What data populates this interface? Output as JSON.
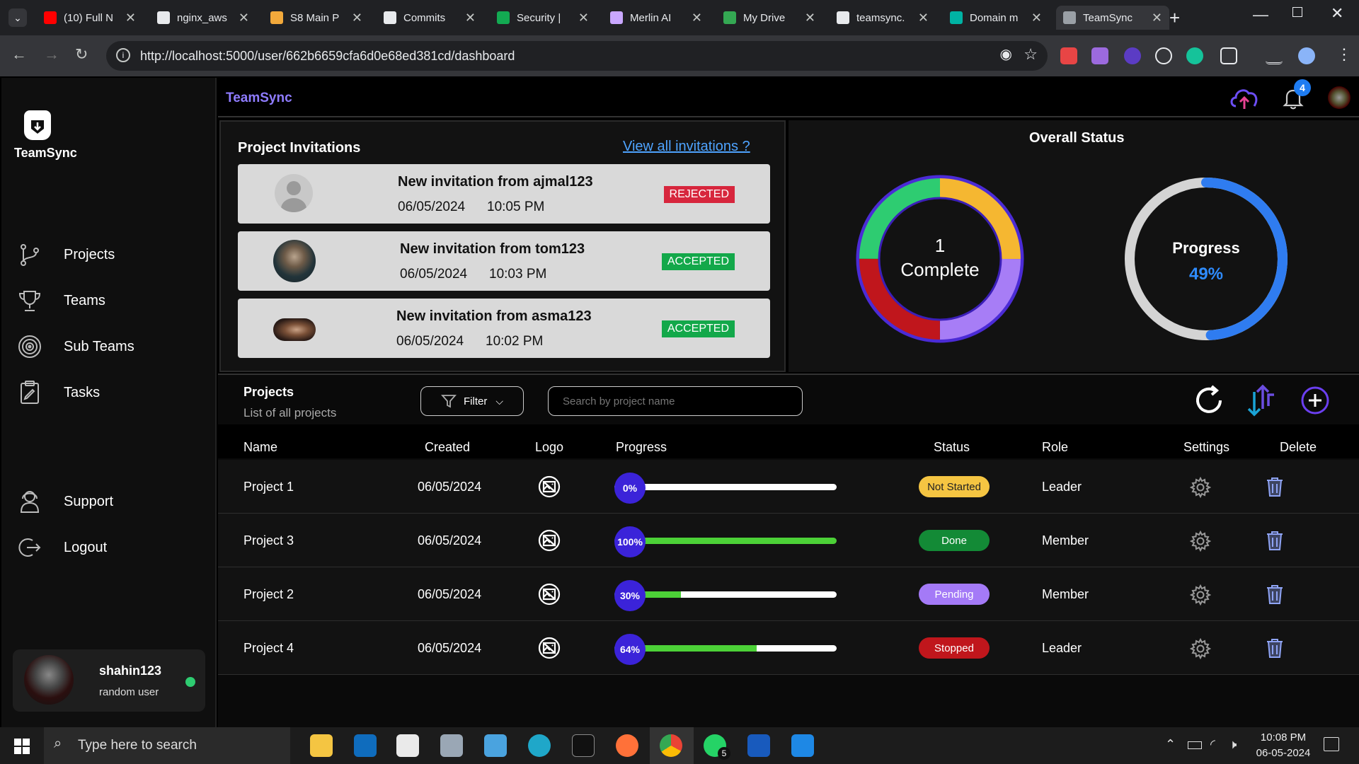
{
  "browser": {
    "tabs": [
      {
        "title": "(10) Full N",
        "color": "#ff0000"
      },
      {
        "title": "nginx_aws",
        "color": "#e8eaed"
      },
      {
        "title": "S8 Main P",
        "color": "#f2a93b"
      },
      {
        "title": "Commits",
        "color": "#e8eaed"
      },
      {
        "title": "Security |",
        "color": "#13aa52"
      },
      {
        "title": "Merlin AI",
        "color": "#c9a7ff"
      },
      {
        "title": "My Drive",
        "color": "#34a853"
      },
      {
        "title": "teamsync.",
        "color": "#e8eaed"
      },
      {
        "title": "Domain m",
        "color": "#00b3a4"
      },
      {
        "title": "TeamSync",
        "color": "#9aa0a6"
      }
    ],
    "url": "http://localhost:5000/user/662b6659cfa6d0e68ed381cd/dashboard"
  },
  "app": {
    "brand": "TeamSync",
    "sidebar": {
      "logo_label": "TeamSync",
      "items": [
        {
          "label": "Projects",
          "icon": "branch-icon"
        },
        {
          "label": "Teams",
          "icon": "trophy-icon"
        },
        {
          "label": "Sub Teams",
          "icon": "target-icon"
        },
        {
          "label": "Tasks",
          "icon": "clipboard-icon"
        },
        {
          "label": "Support",
          "icon": "support-icon"
        },
        {
          "label": "Logout",
          "icon": "logout-icon"
        }
      ],
      "user": {
        "name": "shahin123",
        "role": "random user",
        "online_color": "#2ecc71"
      }
    },
    "header": {
      "notification_count": "4"
    },
    "invitations": {
      "title": "Project Invitations",
      "view_all": "View all invitations ?",
      "items": [
        {
          "text": "New invitation from ajmal123",
          "date": "06/05/2024",
          "time": "10:05 PM",
          "status": "REJECTED",
          "color": "#d7263d"
        },
        {
          "text": "New invitation from tom123",
          "date": "06/05/2024",
          "time": "10:03 PM",
          "status": "ACCEPTED",
          "color": "#13a84a"
        },
        {
          "text": "New invitation from asma123",
          "date": "06/05/2024",
          "time": "10:02 PM",
          "status": "ACCEPTED",
          "color": "#13a84a"
        }
      ]
    },
    "overall": {
      "title": "Overall Status",
      "complete_count": "1",
      "complete_label": "Complete",
      "progress_label": "Progress",
      "progress_value": "49%",
      "progress_fraction": 0.49,
      "donut_segments": [
        {
          "color": "#f5b731",
          "value": 1
        },
        {
          "color": "#a77df6",
          "value": 1
        },
        {
          "color": "#c0161c",
          "value": 1
        },
        {
          "color": "#2ecc71",
          "value": 1
        }
      ]
    },
    "projects": {
      "title": "Projects",
      "subtitle": "List of all projects",
      "filter_label": "Filter",
      "search_placeholder": "Search by project name",
      "columns": [
        "Name",
        "Created",
        "Logo",
        "Progress",
        "Status",
        "Role",
        "Settings",
        "Delete"
      ],
      "rows": [
        {
          "name": "Project 1",
          "created": "06/05/2024",
          "progress": "0%",
          "progress_fraction": 0,
          "status": "Not Started",
          "status_bg": "#f5c542",
          "status_fg": "#222",
          "role": "Leader"
        },
        {
          "name": "Project 3",
          "created": "06/05/2024",
          "progress": "100%",
          "progress_fraction": 1,
          "status": "Done",
          "status_bg": "#138a36",
          "status_fg": "#fff",
          "role": "Member"
        },
        {
          "name": "Project 2",
          "created": "06/05/2024",
          "progress": "30%",
          "progress_fraction": 0.3,
          "status": "Pending",
          "status_bg": "#a47af7",
          "status_fg": "#fff",
          "role": "Member"
        },
        {
          "name": "Project 4",
          "created": "06/05/2024",
          "progress": "64%",
          "progress_fraction": 0.64,
          "status": "Stopped",
          "status_bg": "#c0161c",
          "status_fg": "#fff",
          "role": "Leader"
        }
      ]
    }
  },
  "taskbar": {
    "search_placeholder": "Type here to search",
    "time": "10:08 PM",
    "date": "06-05-2024",
    "whatsapp_count": "5"
  }
}
